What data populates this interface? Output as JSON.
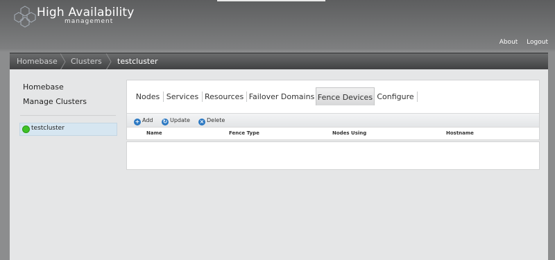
{
  "app": {
    "brand_title": "High Availability",
    "brand_subtitle": "management",
    "top_links": [
      "About",
      "Logout"
    ]
  },
  "breadcrumb": {
    "items": [
      "Homebase",
      "Clusters",
      "testcluster"
    ]
  },
  "sidebar": {
    "links": [
      "Homebase",
      "Manage Clusters"
    ],
    "clusters": [
      {
        "label": "testcluster",
        "status": "running"
      }
    ]
  },
  "tabs": {
    "items": [
      "Nodes",
      "Services",
      "Resources",
      "Failover Domains",
      "Fence Devices",
      "Configure"
    ],
    "active": "Fence Devices"
  },
  "toolbar": {
    "add_label": "Add",
    "update_label": "Update",
    "delete_label": "Delete"
  },
  "table": {
    "columns": [
      "Name",
      "Fence Type",
      "Nodes Using",
      "Hostname"
    ],
    "rows": []
  },
  "colors": {
    "accent_blue": "#2b78c2",
    "status_green": "#3ec227"
  }
}
